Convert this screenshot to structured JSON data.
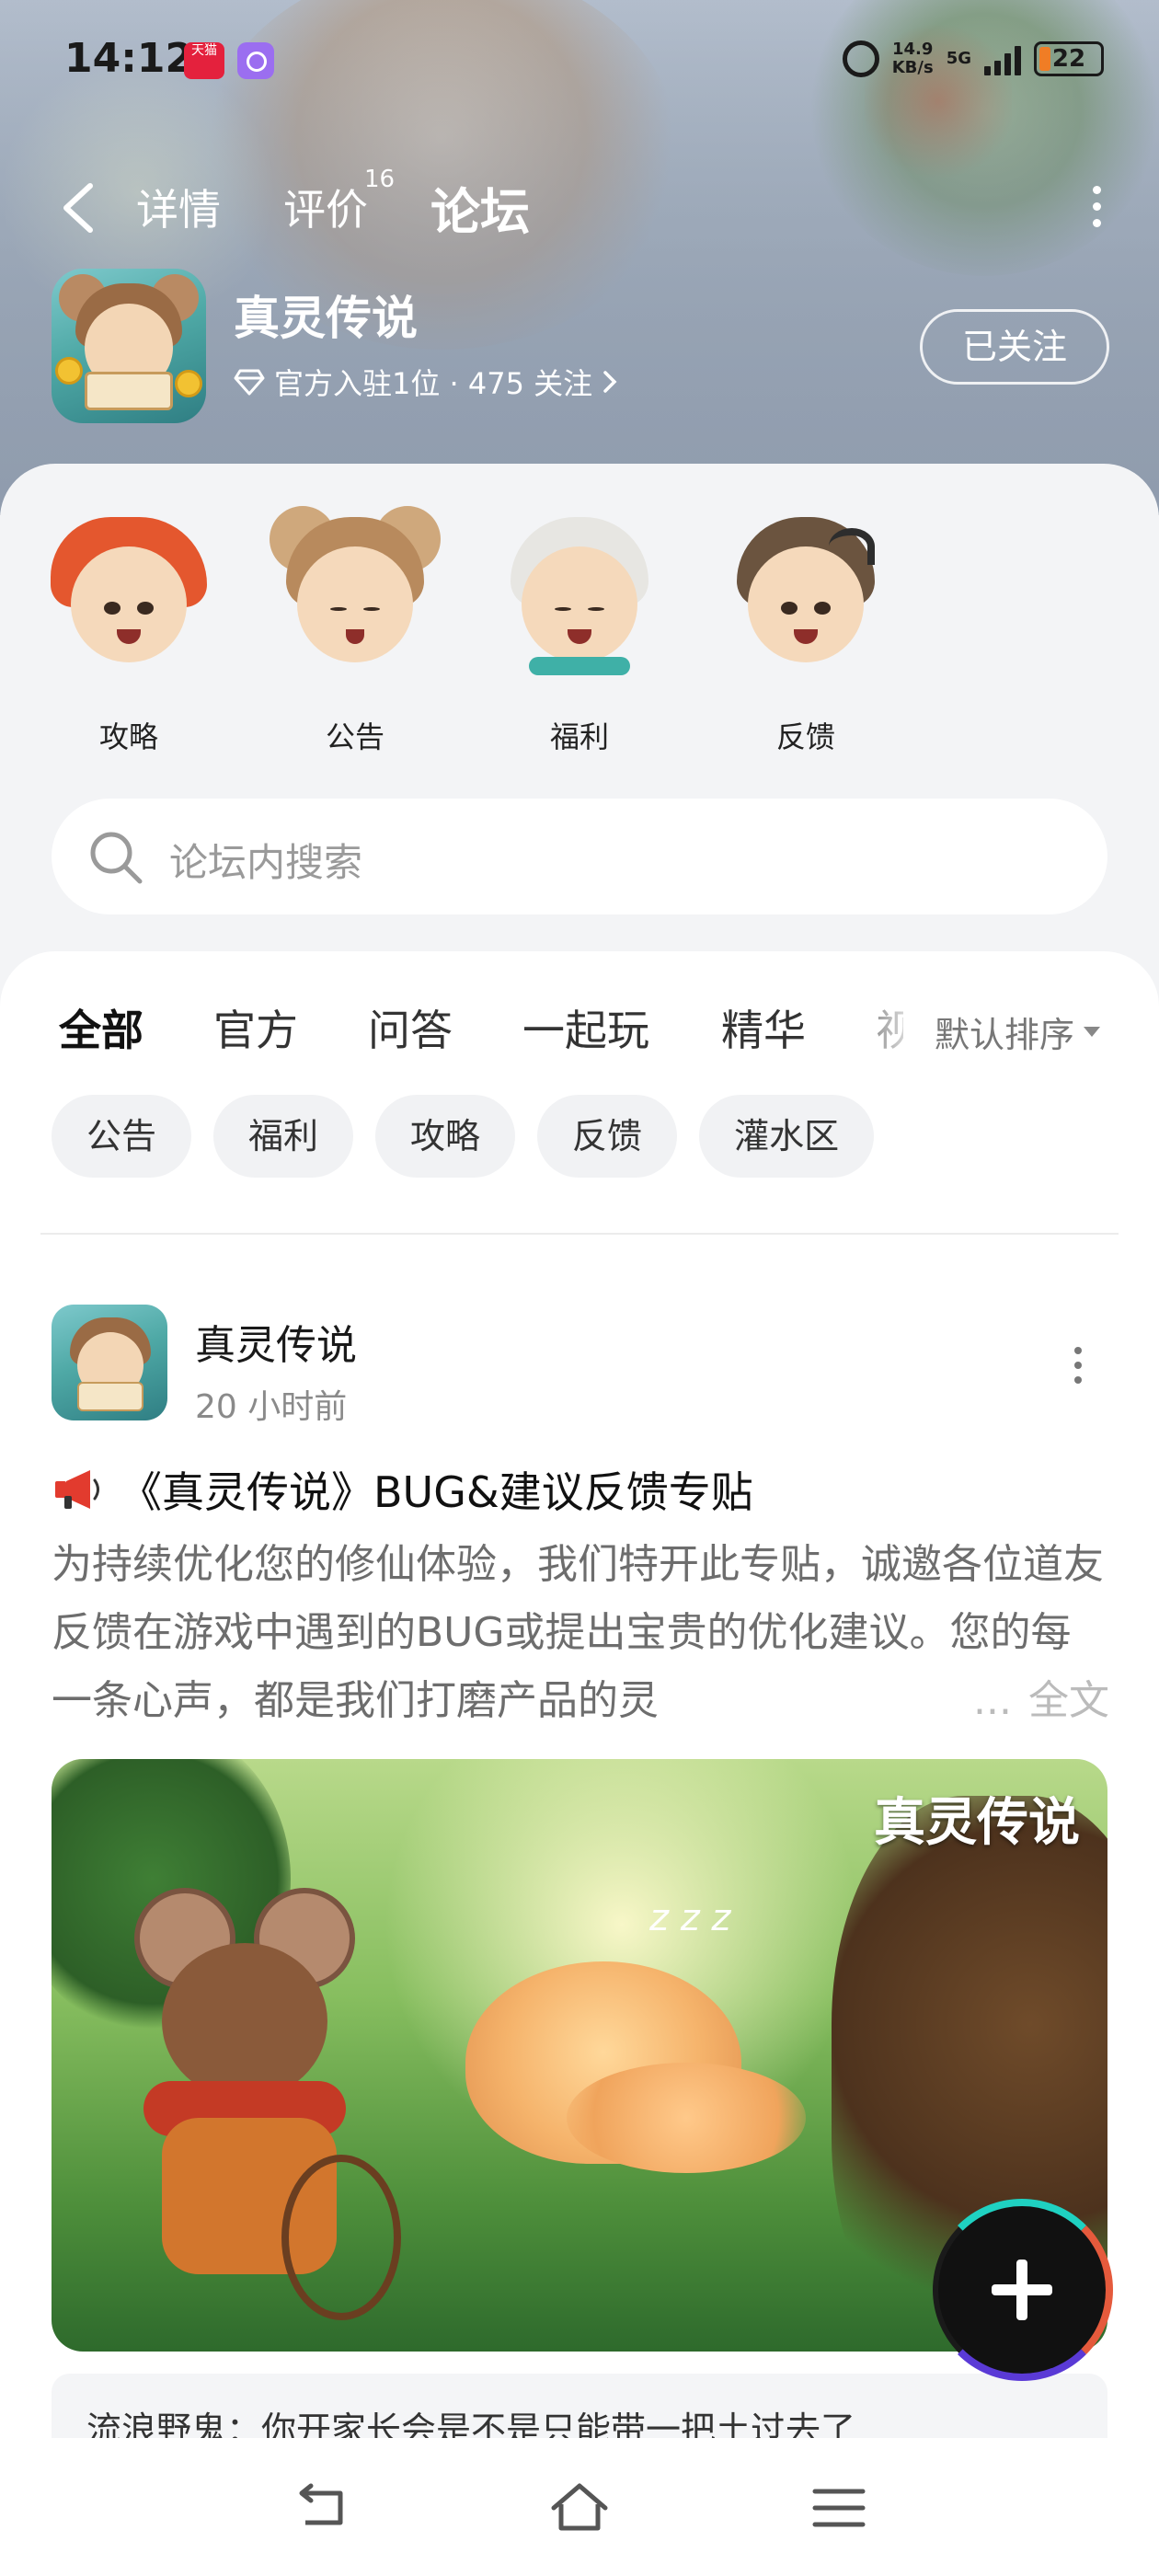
{
  "status_bar": {
    "time": "14:12",
    "app_badge_1": "天猫",
    "net_speed_value": "14.9",
    "net_speed_unit": "KB/s",
    "network": "5G",
    "battery": "22"
  },
  "nav": {
    "tabs": [
      {
        "label": "详情"
      },
      {
        "label": "评价",
        "badge": "16"
      },
      {
        "label": "论坛",
        "active": true
      }
    ]
  },
  "game": {
    "name": "真灵传说",
    "meta": "官方入驻1位 · 475 关注",
    "follow_label": "已关注"
  },
  "categories": [
    {
      "label": "攻略"
    },
    {
      "label": "公告"
    },
    {
      "label": "福利"
    },
    {
      "label": "反馈"
    }
  ],
  "search": {
    "placeholder": "论坛内搜索"
  },
  "feed_tabs": [
    {
      "label": "全部",
      "active": true
    },
    {
      "label": "官方"
    },
    {
      "label": "问答"
    },
    {
      "label": "一起玩"
    },
    {
      "label": "精华"
    },
    {
      "label": "视"
    }
  ],
  "sort": {
    "label": "默认排序"
  },
  "chips": [
    {
      "label": "公告"
    },
    {
      "label": "福利"
    },
    {
      "label": "攻略"
    },
    {
      "label": "反馈"
    },
    {
      "label": "灌水区"
    }
  ],
  "post": {
    "author": "真灵传说",
    "time": "20 小时前",
    "title": "《真灵传说》BUG&建议反馈专贴",
    "body": "为持续优化您的修仙体验，我们特开此专贴，诚邀各位道友反馈在游戏中遇到的BUG或提出宝贵的优化建议。您的每一条心声，都是我们打磨产品的灵",
    "ellipsis": "...",
    "full_text_label": "全文",
    "banner_brand": "真灵传说",
    "comment": "流浪野鬼：你开家长会是不是只能带一把土过去了"
  },
  "colors": {
    "accent": "#20d3c2",
    "text_primary": "#111111",
    "text_secondary": "#8a8a8a"
  }
}
